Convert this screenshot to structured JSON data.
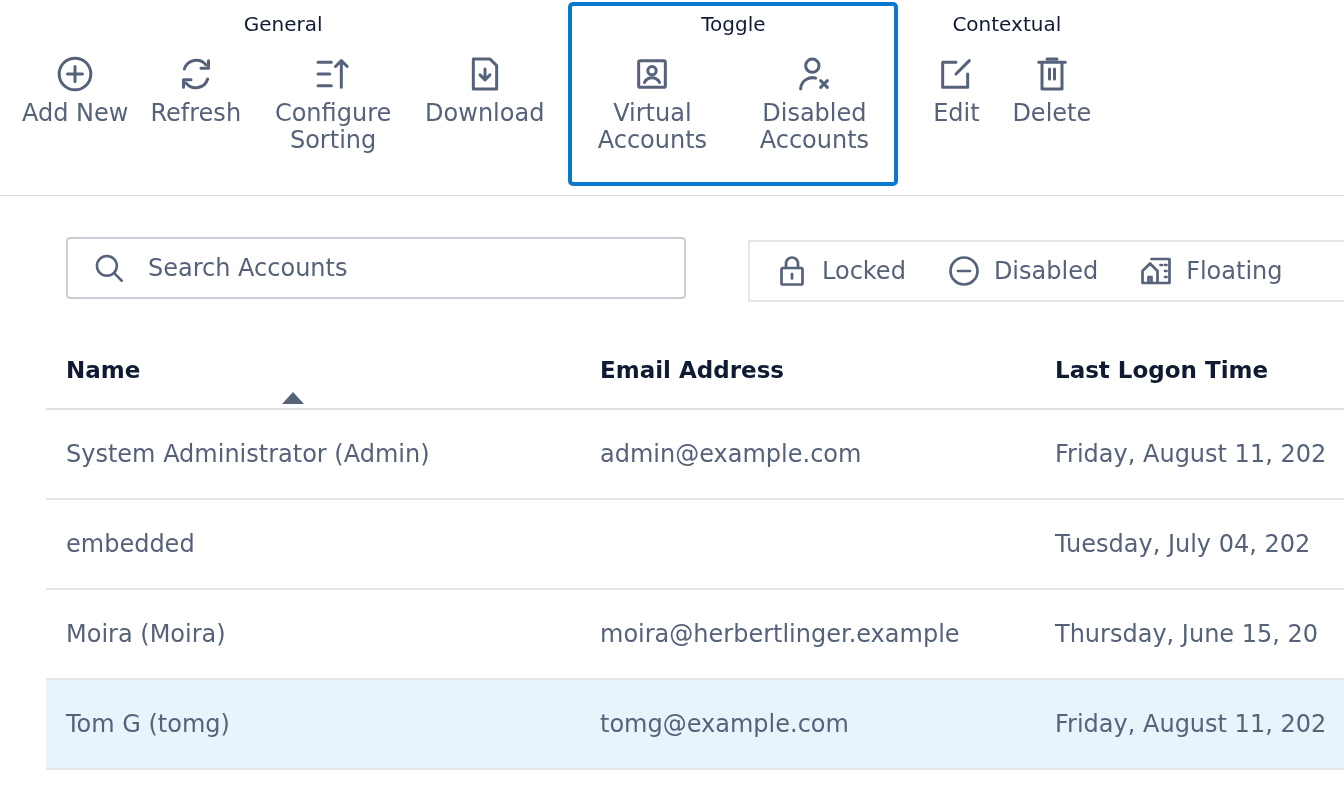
{
  "toolbar": {
    "groups": [
      {
        "title": "General",
        "highlighted": false,
        "buttons": [
          {
            "kind": "add",
            "label": "Add New"
          },
          {
            "kind": "refresh",
            "label": "Refresh"
          },
          {
            "kind": "sort",
            "label": "Configure Sorting"
          },
          {
            "kind": "download",
            "label": "Download"
          }
        ]
      },
      {
        "title": "Toggle",
        "highlighted": true,
        "buttons": [
          {
            "kind": "contact",
            "label": "Virtual Accounts"
          },
          {
            "kind": "userx",
            "label": "Disabled Accounts"
          }
        ]
      },
      {
        "title": "Contextual",
        "highlighted": false,
        "buttons": [
          {
            "kind": "edit",
            "label": "Edit"
          },
          {
            "kind": "trash",
            "label": "Delete"
          }
        ]
      }
    ]
  },
  "search": {
    "placeholder": "Search Accounts"
  },
  "legend": [
    {
      "kind": "lock",
      "label": "Locked"
    },
    {
      "kind": "minus",
      "label": "Disabled"
    },
    {
      "kind": "building",
      "label": "Floating"
    }
  ],
  "table": {
    "columns": [
      {
        "label": "Name",
        "sorted": true
      },
      {
        "label": "Email Address",
        "sorted": false
      },
      {
        "label": "Last Logon Time",
        "sorted": false
      }
    ],
    "rows": [
      {
        "selected": false,
        "cells": [
          "System Administrator (Admin)",
          "admin@example.com",
          "Friday, August 11, 202"
        ]
      },
      {
        "selected": false,
        "cells": [
          "embedded",
          "",
          "Tuesday, July 04, 202"
        ]
      },
      {
        "selected": false,
        "cells": [
          "Moira (Moira)",
          "moira@herbertlinger.example",
          "Thursday, June 15, 20"
        ]
      },
      {
        "selected": true,
        "cells": [
          "Tom G (tomg)",
          "tomg@example.com",
          "Friday, August 11, 202"
        ]
      }
    ]
  }
}
